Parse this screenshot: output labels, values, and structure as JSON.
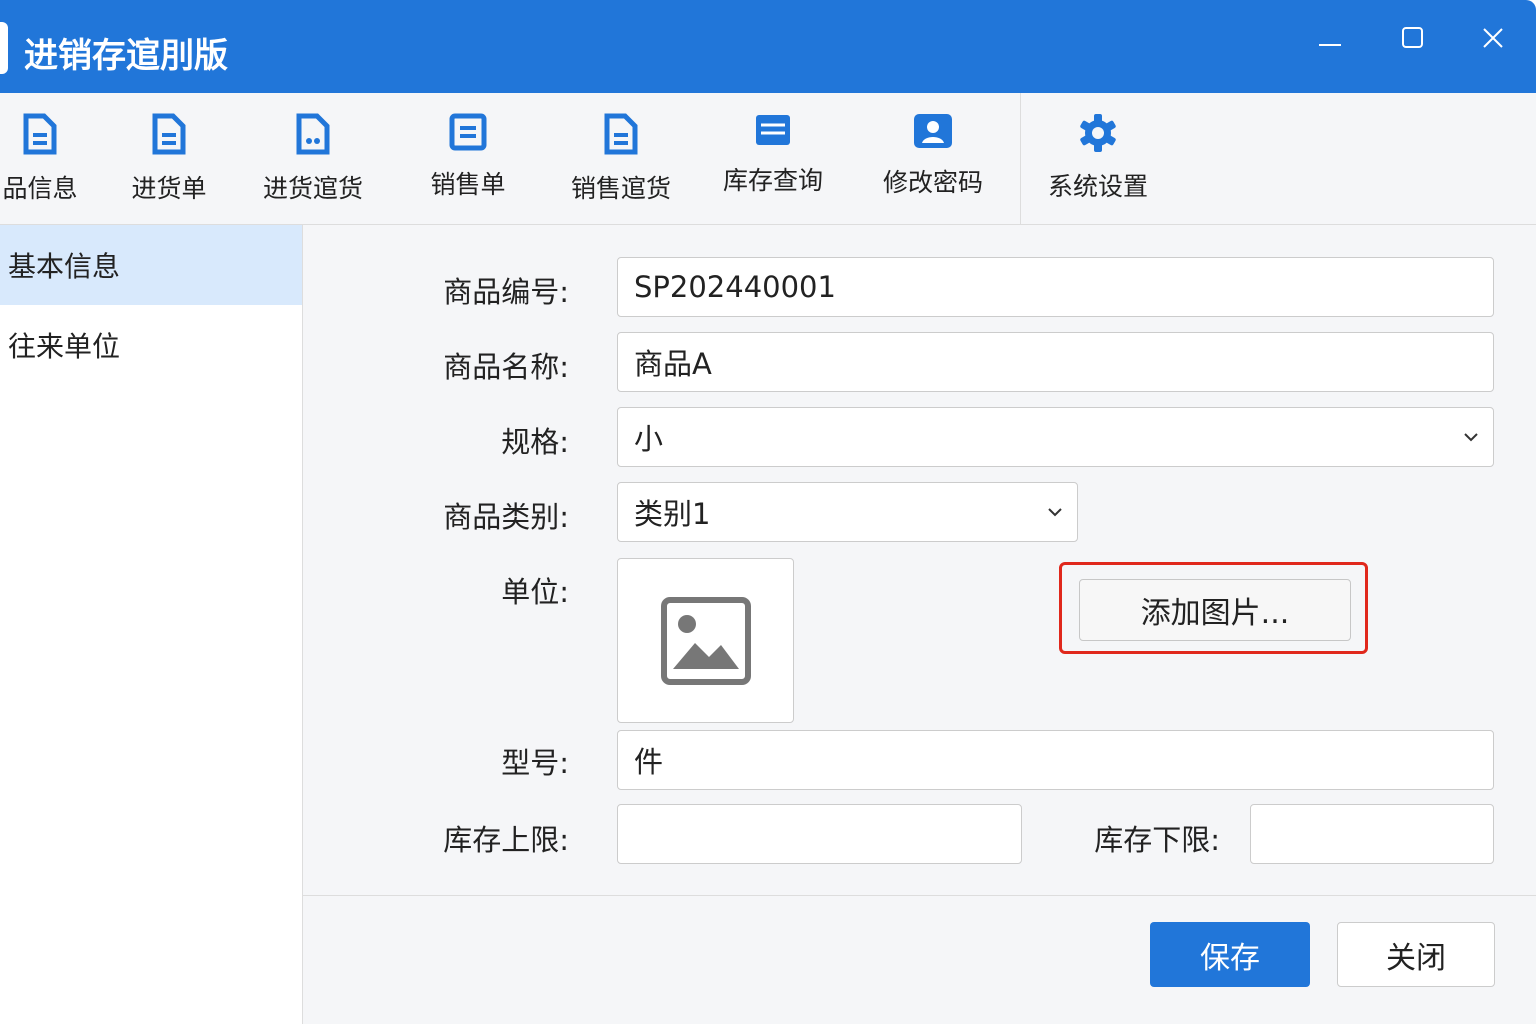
{
  "window": {
    "title": "进销存逭刖版"
  },
  "toolbar": [
    {
      "label": "品信息",
      "icon": "document-icon"
    },
    {
      "label": "进货单",
      "icon": "document-icon"
    },
    {
      "label": "进货逭货",
      "icon": "return-document-icon"
    },
    {
      "label": "销售单",
      "icon": "list-icon"
    },
    {
      "label": "销售逭货",
      "icon": "document-icon"
    },
    {
      "label": "库存查询",
      "icon": "table-icon"
    },
    {
      "label": "修改密码",
      "icon": "user-icon"
    },
    {
      "label": "系统设置",
      "icon": "gear-icon"
    }
  ],
  "sidebar": [
    {
      "label": "基本信息"
    },
    {
      "label": "往来单位"
    }
  ],
  "form": {
    "code_label": "商品编号:",
    "code_value": "SP202440001",
    "name_label": "商品名称:",
    "name_value": "商品A",
    "spec_label": "规格:",
    "spec_value": "小",
    "category_label": "商品类别:",
    "category_value": "类别1",
    "unit_label": "单位:",
    "add_image": "添加图片...",
    "model_label": "型号:",
    "model_value": "件",
    "max_label": "库存上限:",
    "max_value": "",
    "min_label": "库存下限:",
    "min_value": ""
  },
  "footer": {
    "save": "保存",
    "close": "关闭"
  },
  "colors": {
    "accent": "#2176d9",
    "highlight": "#e0281c"
  }
}
